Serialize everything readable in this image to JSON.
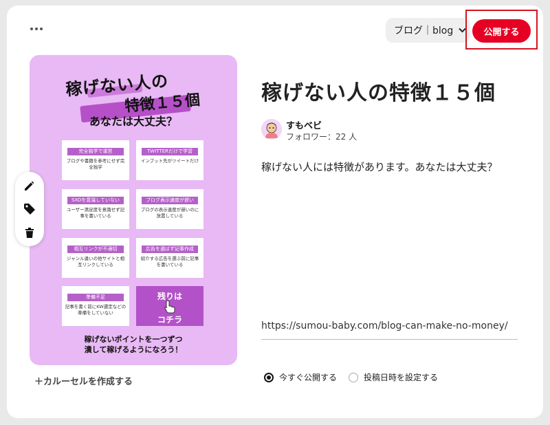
{
  "toolbar": {
    "board_label": "ブログ｜blog",
    "publish_label": "公開する"
  },
  "pin_image": {
    "title_line1": "稼げない人の",
    "title_line2": "特徴１５個",
    "subtitle": "あなたは大丈夫？",
    "tiles": [
      {
        "tag": "完全独学で運営",
        "desc": "ブログや書籍を参考にせず完全独学"
      },
      {
        "tag": "TWITTERだけで学習",
        "desc": "インプット先がツイートだけ"
      },
      {
        "tag": "SXOを意識していない",
        "desc": "ユーザー満足度を意識せず記事を書いている"
      },
      {
        "tag": "ブログ表示速度が遅い",
        "desc": "ブログの表示速度が遅いのに放置している"
      },
      {
        "tag": "相互リンクが不適切",
        "desc": "ジャンル違いの他サイトと相互リンクしている"
      },
      {
        "tag": "広告を選ばず記事作成",
        "desc": "紹介する広告を選ぶ前に記事を書いている"
      },
      {
        "tag": "準備不足",
        "desc": "記事を書く前にKW選定などの準備をしていない"
      }
    ],
    "cta_line1": "残りは",
    "cta_line2": "コチラ",
    "footer_line1": "稼げないポイントを一つずつ",
    "footer_line2": "潰して稼げるようになろう！"
  },
  "carousel_label": "＋カルーセルを作成する",
  "pin": {
    "title": "稼げない人の特徴１５個",
    "author": "すもベビ",
    "followers": "フォロワー：22 人",
    "description": "稼げない人には特徴があります。あなたは大丈夫？",
    "link": "https://sumou-baby.com/blog-can-make-no-money/"
  },
  "publish_options": {
    "now_label": "今すぐ公開する",
    "schedule_label": "投稿日時を設定する",
    "selected": "now"
  },
  "colors": {
    "accent": "#e60023",
    "pin_bg": "#e8b9f4",
    "tag_bg": "#b560c9"
  }
}
